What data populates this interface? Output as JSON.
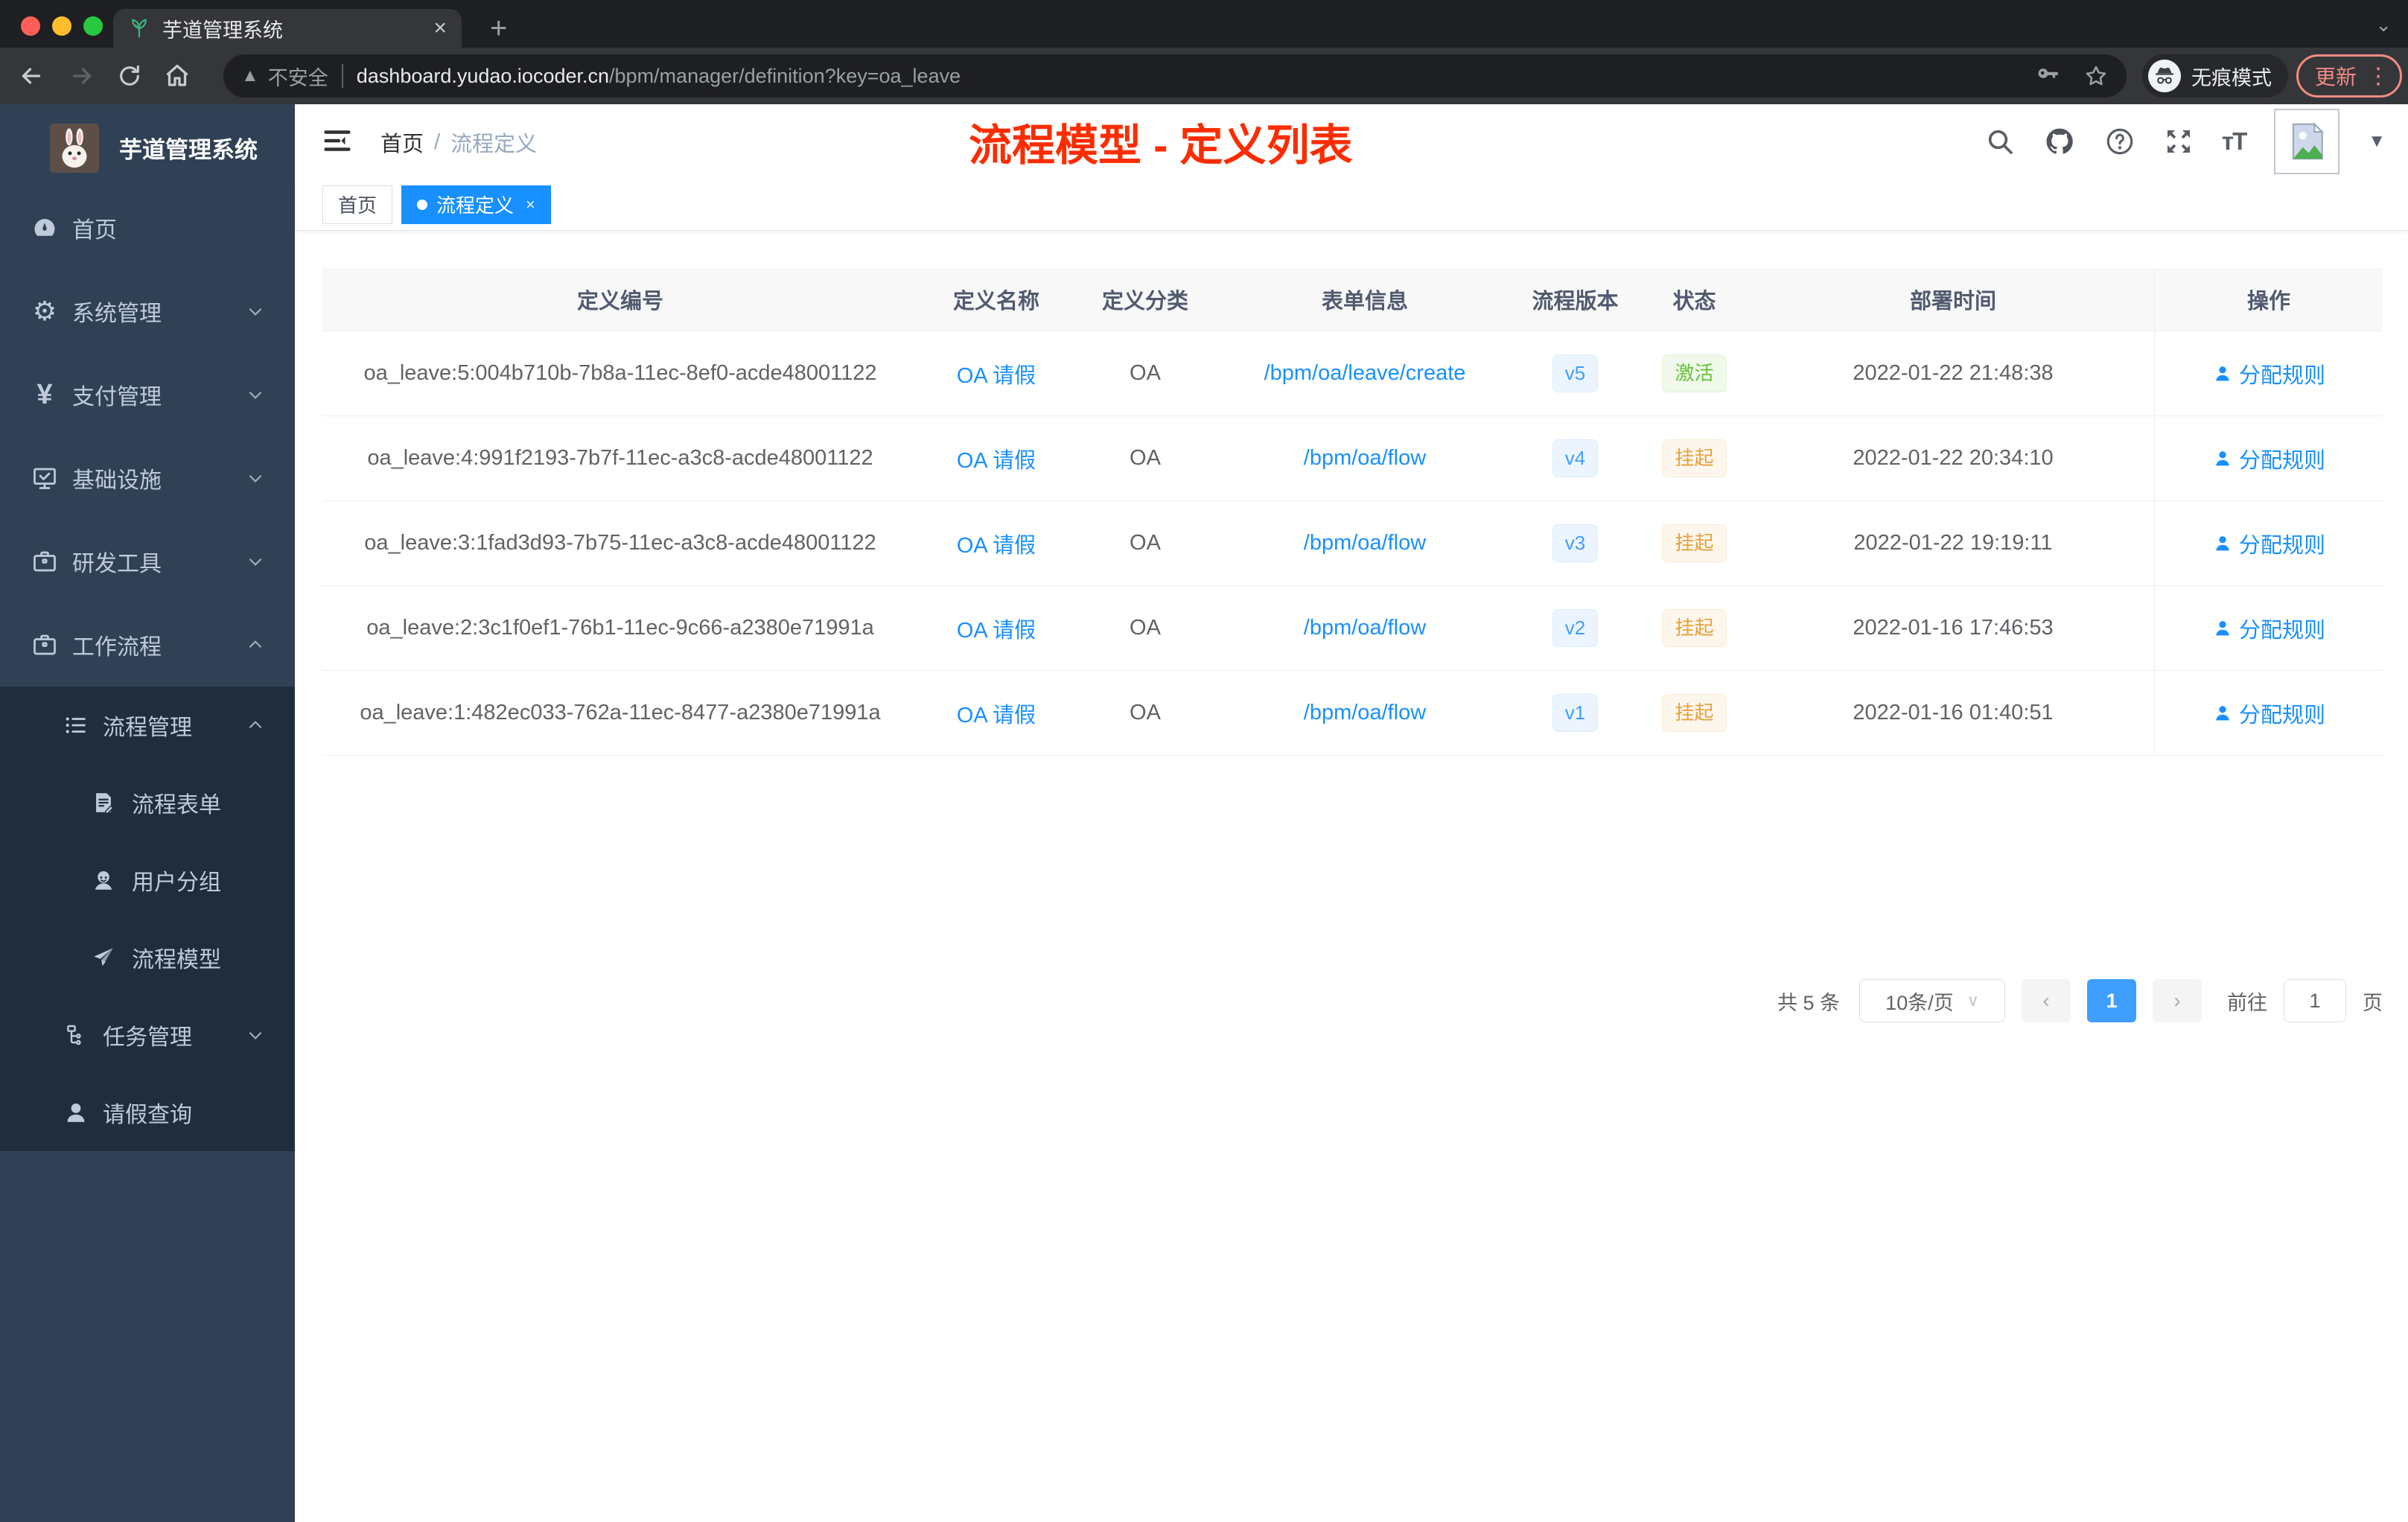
{
  "colors": {
    "accent_blue": "#1890ff",
    "element_blue": "#409eff",
    "success_green": "#67c23a",
    "warning_orange": "#e6a23c",
    "annotation_red": "#fb2d00",
    "sidebar_bg": "#304156",
    "submenu_bg": "#1f2d3d",
    "chrome_dark": "#1e1f22",
    "chrome_toolbar": "#35363a",
    "update_coral": "#f28b82"
  },
  "browser": {
    "tab_title": "芋道管理系统",
    "tab_close": "×",
    "new_tab": "+",
    "security_label": "不安全",
    "url_host": "dashboard.yudao.iocoder.cn",
    "url_path": "/bpm/manager/definition?key=oa_leave",
    "incognito_label": "无痕模式",
    "update_label": "更新",
    "menu_dots": "⋮"
  },
  "sidebar": {
    "logo_title": "芋道管理系统",
    "items": [
      {
        "label": "首页",
        "icon": "dashboard-icon"
      },
      {
        "label": "系统管理",
        "icon": "gear-icon",
        "arrow": "down"
      },
      {
        "label": "支付管理",
        "icon": "yen-icon",
        "arrow": "down"
      },
      {
        "label": "基础设施",
        "icon": "monitor-icon",
        "arrow": "down"
      },
      {
        "label": "研发工具",
        "icon": "briefcase-icon",
        "arrow": "down"
      },
      {
        "label": "工作流程",
        "icon": "briefcase-icon",
        "arrow": "up"
      },
      {
        "label": "流程管理",
        "icon": "list-icon",
        "arrow": "up"
      },
      {
        "label": "流程表单",
        "icon": "form-icon"
      },
      {
        "label": "用户分组",
        "icon": "users-icon"
      },
      {
        "label": "流程模型",
        "icon": "send-icon"
      },
      {
        "label": "任务管理",
        "icon": "tree-icon",
        "arrow": "down"
      },
      {
        "label": "请假查询",
        "icon": "user-icon"
      }
    ]
  },
  "header": {
    "breadcrumb_home": "首页",
    "breadcrumb_sep": "/",
    "breadcrumb_current": "流程定义",
    "annotation": "流程模型 - 定义列表"
  },
  "tags": {
    "home": {
      "label": "首页"
    },
    "active": {
      "label": "流程定义",
      "close": "×"
    }
  },
  "table": {
    "columns": {
      "id": "定义编号",
      "name": "定义名称",
      "category": "定义分类",
      "form": "表单信息",
      "version": "流程版本",
      "status": "状态",
      "time": "部署时间",
      "action": "操作"
    },
    "rows": [
      {
        "id": "oa_leave:5:004b710b-7b8a-11ec-8ef0-acde48001122",
        "name": "OA 请假",
        "category": "OA",
        "form": "/bpm/oa/leave/create",
        "version": "v5",
        "status": "激活",
        "status_type": "success",
        "time": "2022-01-22 21:48:38",
        "action": "分配规则"
      },
      {
        "id": "oa_leave:4:991f2193-7b7f-11ec-a3c8-acde48001122",
        "name": "OA 请假",
        "category": "OA",
        "form": "/bpm/oa/flow",
        "version": "v4",
        "status": "挂起",
        "status_type": "warning",
        "time": "2022-01-22 20:34:10",
        "action": "分配规则"
      },
      {
        "id": "oa_leave:3:1fad3d93-7b75-11ec-a3c8-acde48001122",
        "name": "OA 请假",
        "category": "OA",
        "form": "/bpm/oa/flow",
        "version": "v3",
        "status": "挂起",
        "status_type": "warning",
        "time": "2022-01-22 19:19:11",
        "action": "分配规则"
      },
      {
        "id": "oa_leave:2:3c1f0ef1-76b1-11ec-9c66-a2380e71991a",
        "name": "OA 请假",
        "category": "OA",
        "form": "/bpm/oa/flow",
        "version": "v2",
        "status": "挂起",
        "status_type": "warning",
        "time": "2022-01-16 17:46:53",
        "action": "分配规则"
      },
      {
        "id": "oa_leave:1:482ec033-762a-11ec-8477-a2380e71991a",
        "name": "OA 请假",
        "category": "OA",
        "form": "/bpm/oa/flow",
        "version": "v1",
        "status": "挂起",
        "status_type": "warning",
        "time": "2022-01-16 01:40:51",
        "action": "分配规则"
      }
    ]
  },
  "pagination": {
    "total": "共 5 条",
    "page_size": "10条/页",
    "prev": "‹",
    "current_page": "1",
    "next": "›",
    "goto_label": "前往",
    "goto_value": "1",
    "page_unit": "页"
  }
}
